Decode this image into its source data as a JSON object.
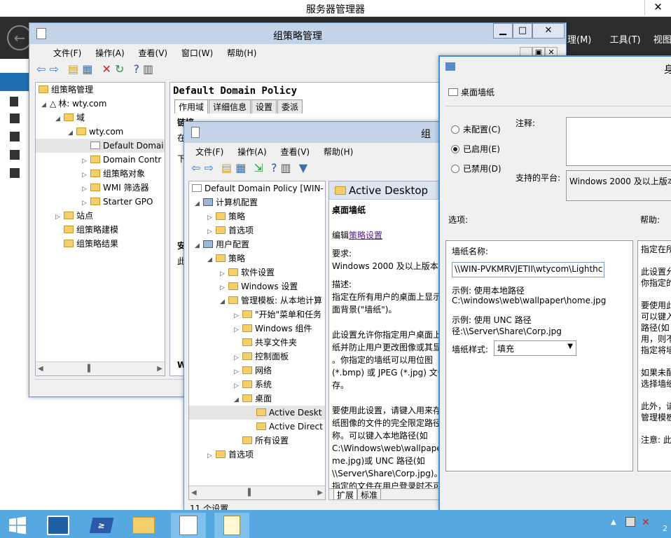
{
  "server_manager": {
    "title": "服务器管理器",
    "menus": [
      "理(M)",
      "工具(T)",
      "视图(V)"
    ]
  },
  "gpm": {
    "title": "组策略管理",
    "menu": [
      "文件(F)",
      "操作(A)",
      "查看(V)",
      "窗口(W)",
      "帮助(H)"
    ],
    "tree": [
      "组策略管理",
      "林: wty.com",
      "域",
      "wty.com",
      "Default Domai",
      "Domain Contr",
      "组策略对象",
      "WMI 筛选器",
      "Starter GPO",
      "站点",
      "组策略建模",
      "组策略结果"
    ],
    "right_title": "Default Domain Policy",
    "tabs": [
      "作用域",
      "详细信息",
      "设置",
      "委派"
    ],
    "right_text": {
      "link": "链接",
      "in": "在",
      "bottom_label": "下",
      "sec": "安",
      "this": "此",
      "w": "W"
    }
  },
  "gpe": {
    "title": "组",
    "menu": [
      "文件(F)",
      "操作(A)",
      "查看(V)",
      "帮助(H)"
    ],
    "tree": [
      "Default Domain Policy [WIN-",
      "计算机配置",
      "策略",
      "首选项",
      "用户配置",
      "策略",
      "软件设置",
      "Windows 设置",
      "管理模板: 从本地计算",
      "\"开始\"菜单和任务",
      "Windows 组件",
      "共享文件夹",
      "控制面板",
      "网络",
      "系统",
      "桌面",
      "Active Deskt",
      "Active Direct",
      "所有设置",
      "首选项"
    ],
    "detail": {
      "header": "Active Desktop",
      "setting": "桌面墙纸",
      "edit_prefix": "编辑",
      "edit_link": "策略设置",
      "req_label": "要求:",
      "req_text": "Windows 2000 及以上版本",
      "desc_label": "描述:",
      "desc1": "指定在所有用户的桌面上显示的",
      "desc2": "面背景(\"墙纸\")。",
      "p2a": "此设置允许你指定用户桌面上",
      "p2b": "纸并防止用户更改图像或其显",
      "p2c": "。你指定的墙纸可以用位图",
      "p2d": "(*.bmp) 或 JPEG (*.jpg) 文件",
      "p2e": "存。",
      "p3a": "要使用此设置，请键入用来存",
      "p3b": "纸图像的文件的完全限定路径",
      "p3c": "称。可以键入本地路径(如",
      "p3d": "C:\\Windows\\web\\wallpape",
      "p3e": "me.jpg)或 UNC 路径(如",
      "p3f": "\\\\Server\\Share\\Corp.jpg)。",
      "p3g": "指定的文件在用户登录时不可"
    },
    "bottom_tabs": [
      "扩展",
      "标准"
    ],
    "status": "11 个设置"
  },
  "dialog": {
    "title_fragment": "身",
    "setting_name": "桌面墙纸",
    "radio": [
      "未配置(C)",
      "已启用(E)",
      "已禁用(D)"
    ],
    "selected": 1,
    "comment_label": "注释:",
    "platform_label": "支持的平台:",
    "platform_value": "Windows 2000 及以上版本",
    "options_label": "选项:",
    "help_label": "帮助:",
    "wallpaper_name_label": "墙纸名称:",
    "wallpaper_value": "\\\\WIN-PVKMRVJETII\\wtycom\\Lighthc",
    "ex1_label": "示例: 使用本地路径",
    "ex1_value": "C:\\windows\\web\\wallpaper\\home.jpg",
    "ex2_label": "示例: 使用 UNC 路径",
    "ex2_value": "径:\\\\Server\\Share\\Corp.jpg",
    "style_label": "墙纸样式:",
    "style_value": "填充",
    "help_lines": [
      "指定在所",
      "此设置允",
      "你指定的",
      "要使用此",
      "可以键入",
      "路径(如",
      "用，则不",
      "指定将墙",
      "如果未配",
      "选择墙纸",
      "此外，请",
      "管理模板",
      "注意: 此"
    ]
  },
  "taskbar": {
    "time": "2",
    "icons": [
      "start-icon",
      "server-manager-icon",
      "powershell-icon",
      "explorer-icon",
      "gpm-icon",
      "notepad-icon"
    ]
  }
}
